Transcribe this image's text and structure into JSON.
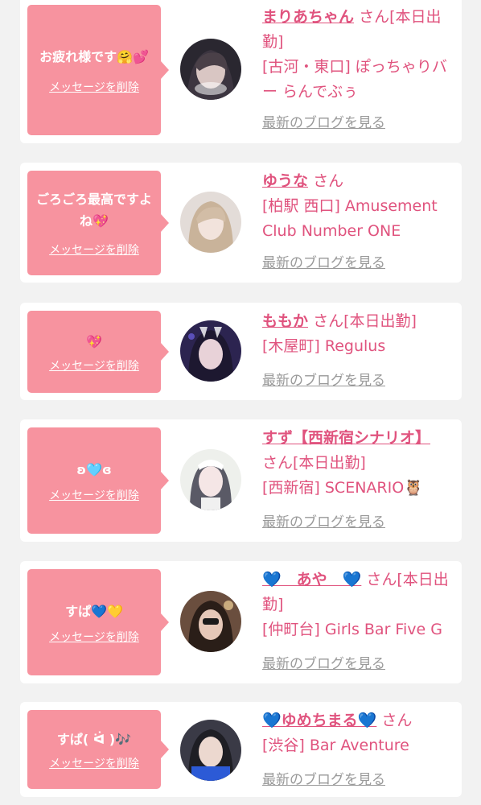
{
  "colors": {
    "background": "#f2f2f2",
    "card": "#ffffff",
    "bubble": "#f7939f",
    "accent_text": "#e0537e",
    "link_gray": "#999999"
  },
  "items": [
    {
      "message": "お疲れ様です🤗💕",
      "delete_label": "メッセージを削除",
      "name": "まりあちゃん",
      "suffix": "さん[本日出勤]",
      "shop": "[古河・東口] ぽっちゃりバー らんでぶぅ",
      "blog_link": "最新のブログを見る",
      "avatar_icon": "profile-photo"
    },
    {
      "message": "ごろごろ最高ですよね💖",
      "delete_label": "メッセージを削除",
      "name": "ゆうな",
      "suffix": "さん",
      "shop": "[柏駅 西口] Amusement Club Number ONE",
      "blog_link": "最新のブログを見る",
      "avatar_icon": "profile-photo"
    },
    {
      "message": "💖",
      "delete_label": "メッセージを削除",
      "name": "ももか",
      "suffix": "さん[本日出勤]",
      "shop": "[木屋町] Regulus",
      "blog_link": "最新のブログを見る",
      "avatar_icon": "profile-photo"
    },
    {
      "message": "ʚ🩵ɞ",
      "delete_label": "メッセージを削除",
      "name": "すず【西新宿シナリオ】",
      "suffix": "さん[本日出勤]",
      "shop": "[西新宿] SCENARIO🦉",
      "blog_link": "最新のブログを見る",
      "avatar_icon": "profile-photo"
    },
    {
      "message": "すぱ💙💛",
      "delete_label": "メッセージを削除",
      "name": "💙　あや　💙",
      "suffix": "さん[本日出勤]",
      "shop": "[仲町台] Girls Bar Five G",
      "blog_link": "最新のブログを見る",
      "avatar_icon": "profile-photo"
    },
    {
      "message": "すぱ( ᐛ )🎶",
      "delete_label": "メッセージを削除",
      "name": "💙ゆめちまる💙",
      "suffix": "さん",
      "shop": "[渋谷] Bar Aventure",
      "blog_link": "最新のブログを見る",
      "avatar_icon": "profile-photo"
    }
  ]
}
